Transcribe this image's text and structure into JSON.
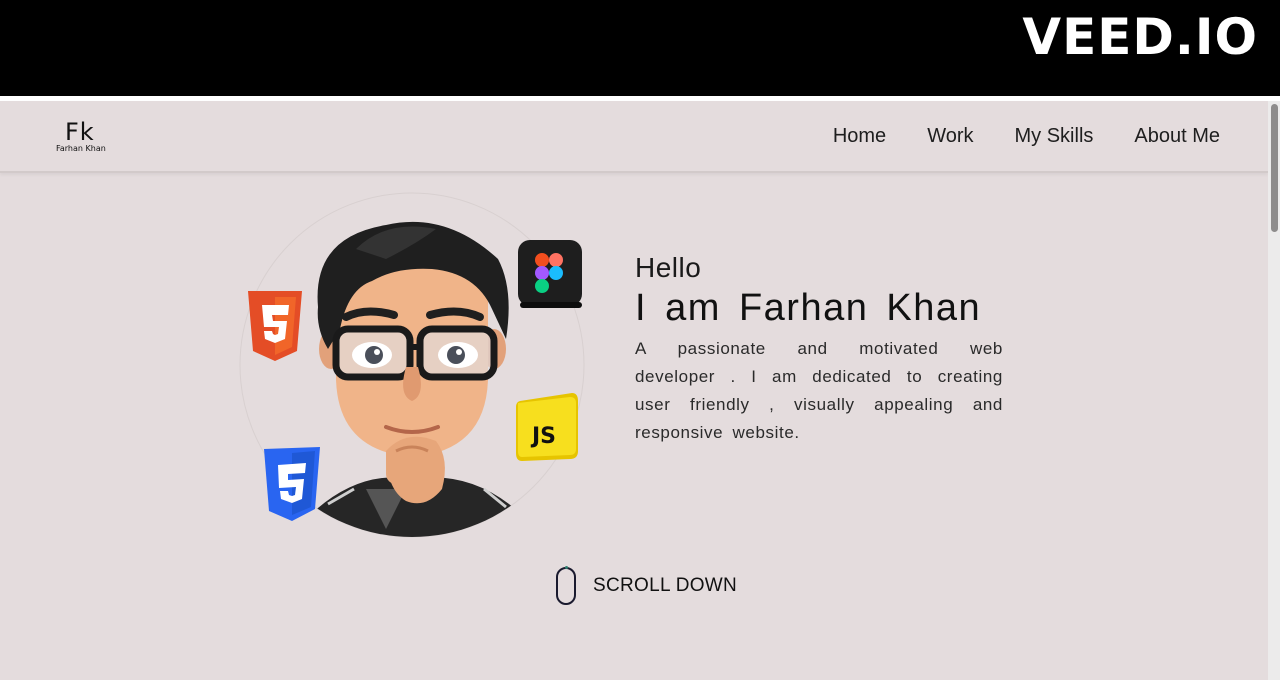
{
  "watermark": {
    "text": "VEED.IO"
  },
  "logo": {
    "mark": "Fk",
    "subtitle": "Farhan Khan"
  },
  "nav": {
    "links": [
      {
        "label": "Home"
      },
      {
        "label": "Work"
      },
      {
        "label": "My Skills"
      },
      {
        "label": "About Me"
      }
    ]
  },
  "hero": {
    "greeting": "Hello",
    "name": "I am Farhan Khan",
    "description": "A passionate and motivated web developer . I am dedicated to creating user friendly , visually appealing and responsive website.",
    "icons": [
      "html5-icon",
      "css3-icon",
      "js-icon",
      "figma-icon"
    ]
  },
  "scroll": {
    "label": "SCROLL DOWN"
  },
  "colors": {
    "page_bg": "#e4dcdd",
    "html5": "#e44d26",
    "css3": "#2965f1",
    "js": "#f7df1e",
    "figma_bg": "#1e1e1e"
  }
}
